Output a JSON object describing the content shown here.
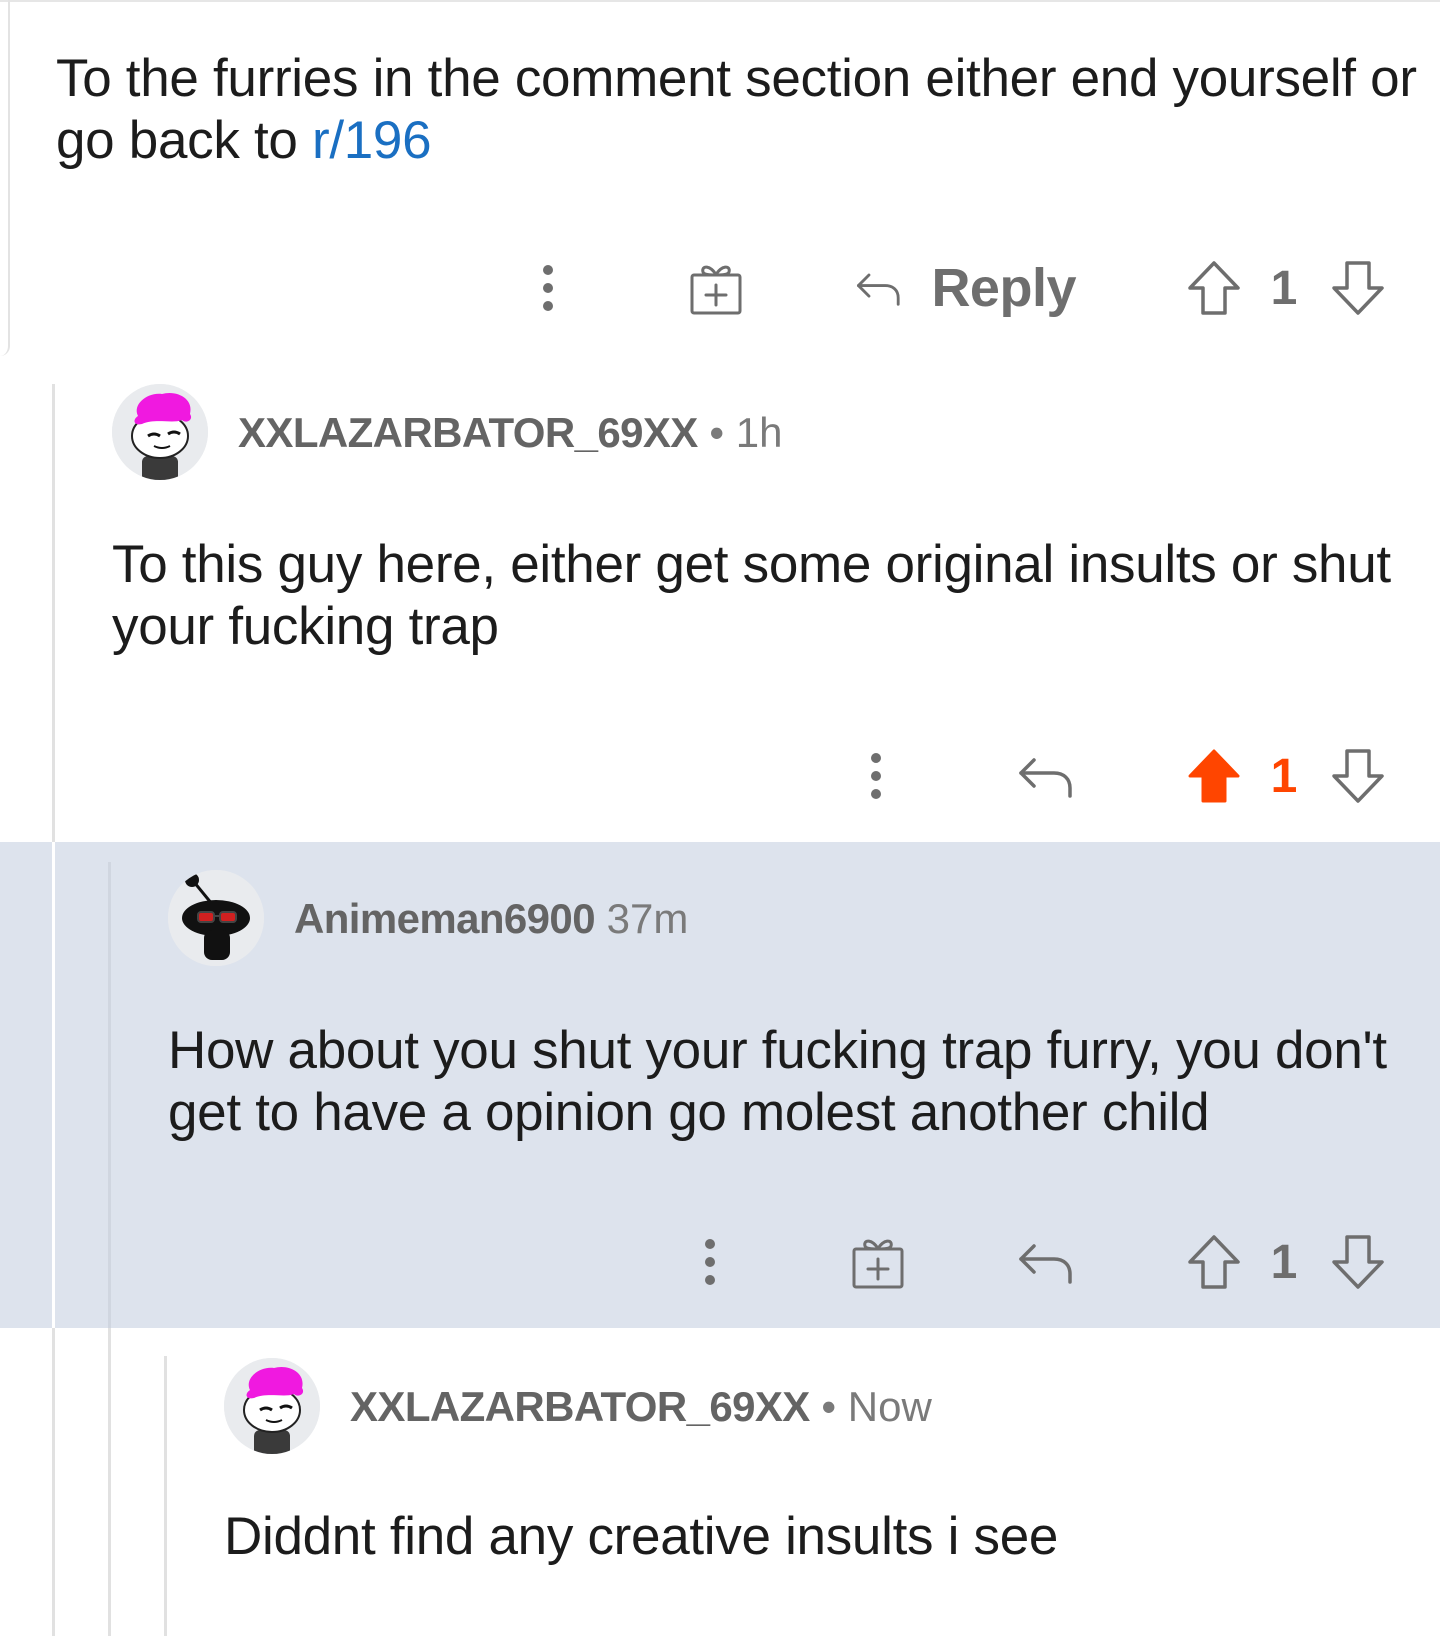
{
  "parent_comment": {
    "text": "To the furries in the comment section either end yourself or go back to ",
    "subreddit_link": "r/196",
    "actions": {
      "more_icon": "more-vertical-icon",
      "award_icon": "gift-icon",
      "reply_label": "Reply",
      "vote_count": "1"
    }
  },
  "comments": [
    {
      "author": "XXLAZARBATOR_69XX",
      "separator": "•",
      "time": "1h",
      "avatar": "snoo-pink-hair-avatar",
      "text": "To this guy here, either get some original insults or shut your fucking trap",
      "vote_count": "1",
      "upvoted": true
    },
    {
      "author": "Animeman6900",
      "time": "37m",
      "avatar": "snoo-black-sunglasses-avatar",
      "text": "How about you shut your fucking trap furry, you don't get to have a opinion go molest another child",
      "vote_count": "1",
      "upvoted": false
    },
    {
      "author": "XXLAZARBATOR_69XX",
      "separator": "•",
      "time": "Now",
      "avatar": "snoo-pink-hair-avatar",
      "text": "Diddnt find any creative insults i see"
    }
  ],
  "colors": {
    "link": "#1a6fc2",
    "upvote_active": "#ff4500",
    "highlight_bg": "#dde3ed",
    "icon_gray": "#6e6e6e"
  }
}
